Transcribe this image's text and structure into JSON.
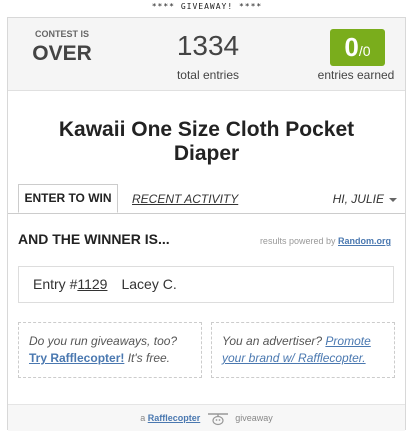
{
  "banner": "**** GIVEAWAY! ****",
  "stats": {
    "contest_small": "CONTEST IS",
    "contest_big": "OVER",
    "total_entries": "1334",
    "total_entries_label": "total entries",
    "entries_earned": "0",
    "entries_earned_total": "/0",
    "entries_earned_label": "entries earned",
    "accent_color": "#7aad1c"
  },
  "title": "Kawaii One Size Cloth Pocket Diaper",
  "tabs": {
    "enter": "ENTER TO WIN",
    "recent": "RECENT ACTIVITY",
    "user": "HI, JULIE"
  },
  "winner": {
    "heading": "AND THE WINNER IS...",
    "powered_prefix": "results powered by",
    "powered_link": "Random.org",
    "entry_prefix": "Entry #",
    "entry_number": "1129",
    "winner_name": "Lacey C."
  },
  "promo_left": {
    "text": "Do you run giveaways, too?",
    "link": "Try Rafflecopter!",
    "suffix": " It's free."
  },
  "promo_right": {
    "text": "You an advertiser? ",
    "link": "Promote your brand w/ Rafflecopter."
  },
  "footer": {
    "prefix": "a",
    "brand": "Rafflecopter",
    "suffix": "giveaway",
    "icon": "rafflecopter-logo-icon"
  }
}
